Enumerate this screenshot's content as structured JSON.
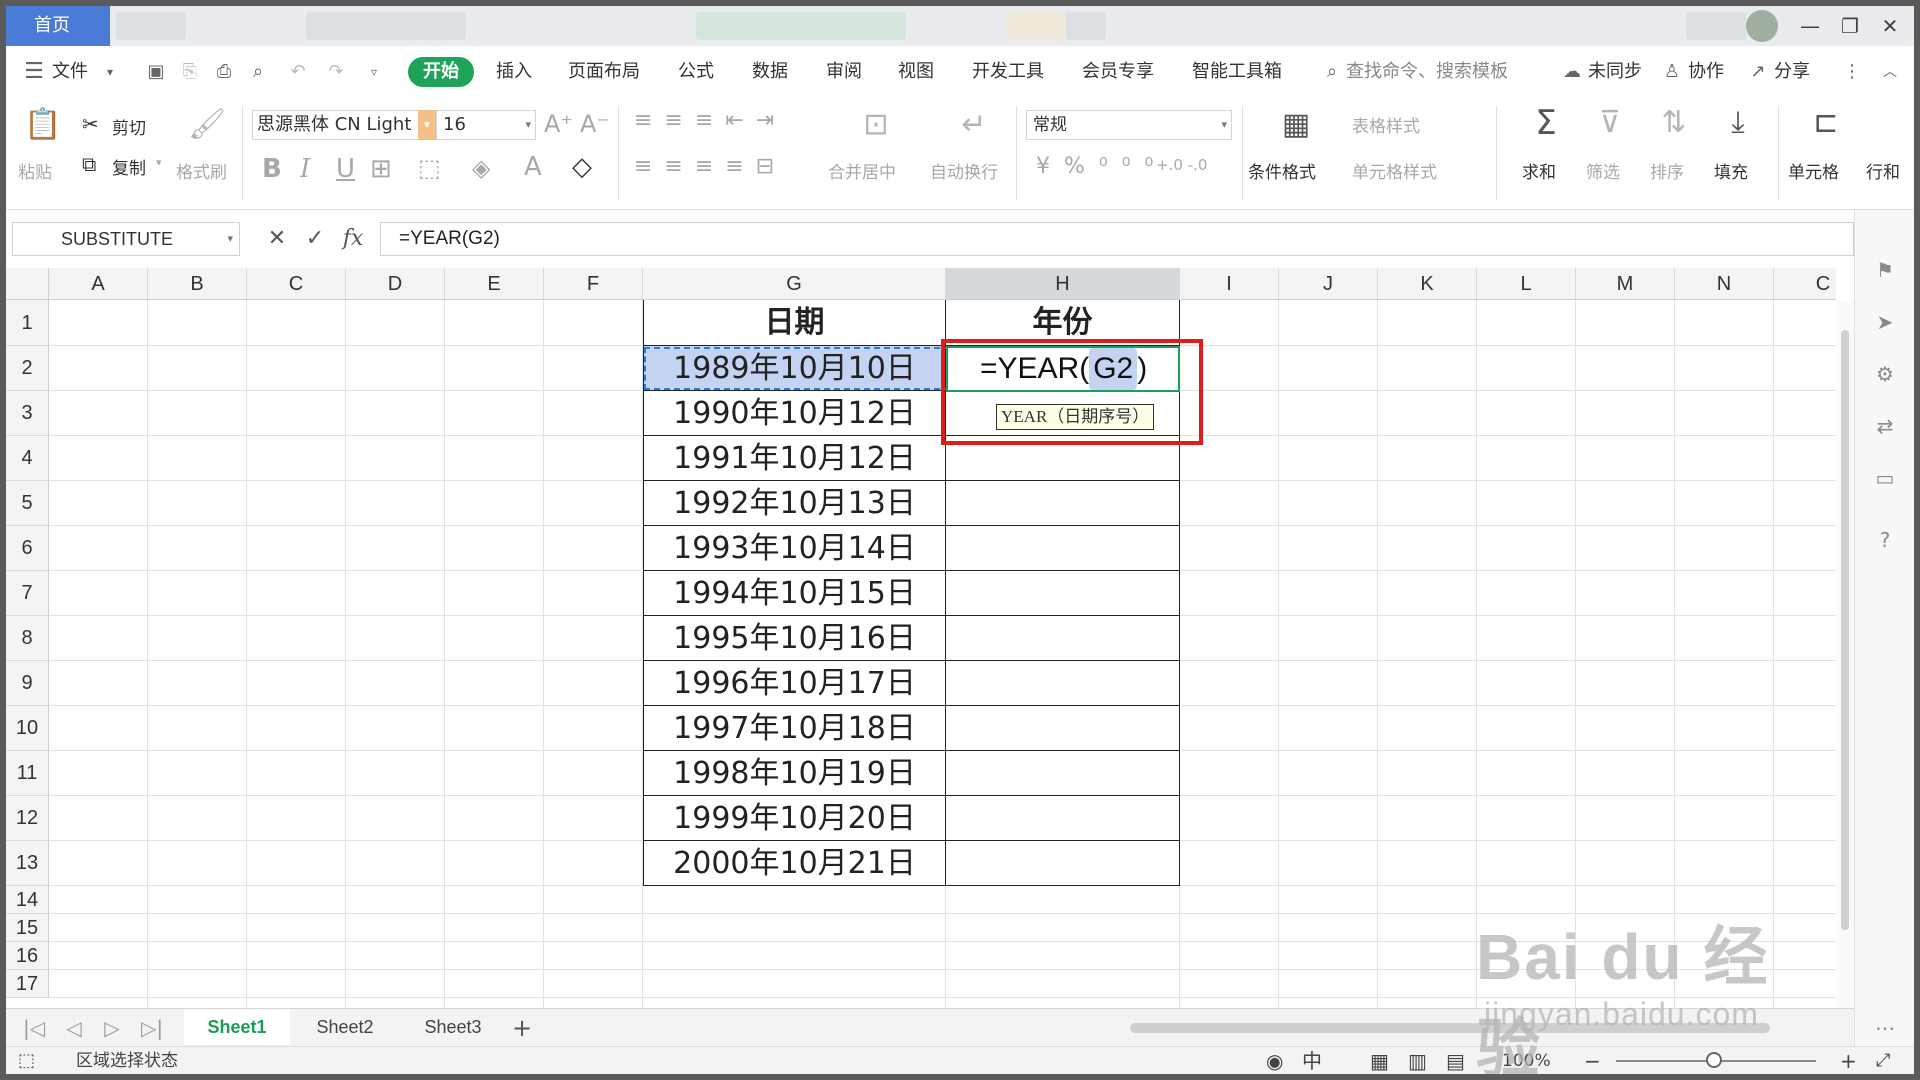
{
  "tabs": {
    "home": "首页"
  },
  "window": {
    "minimize": "—",
    "restore": "❐",
    "close": "✕"
  },
  "menu": {
    "file": "文件",
    "items": [
      "开始",
      "插入",
      "页面布局",
      "公式",
      "数据",
      "审阅",
      "视图",
      "开发工具",
      "会员专享",
      "智能工具箱"
    ],
    "search": "查找命令、搜索模板",
    "sync": "未同步",
    "collab": "协作",
    "share": "分享"
  },
  "ribbon": {
    "paste": "粘贴",
    "cut": "剪切",
    "copy": "复制",
    "format_painter": "格式刷",
    "font_name": "思源黑体 CN Light",
    "font_size": "16",
    "merge": "合并居中",
    "wrap": "自动换行",
    "number_format": "常规",
    "cond_format": "条件格式",
    "table_style": "表格样式",
    "cell_style": "单元格样式",
    "sum": "求和",
    "filter": "筛选",
    "sort": "排序",
    "fill": "填充",
    "cell": "单元格",
    "rowcol": "行和"
  },
  "formula_bar": {
    "name_box": "SUBSTITUTE",
    "formula": "=YEAR(G2)"
  },
  "grid": {
    "columns": [
      "A",
      "B",
      "C",
      "D",
      "E",
      "F",
      "G",
      "H",
      "I",
      "J",
      "K",
      "L",
      "M",
      "N",
      "C"
    ],
    "rows": [
      "1",
      "2",
      "3",
      "4",
      "5",
      "6",
      "7",
      "8",
      "9",
      "10",
      "11",
      "12",
      "13",
      "14",
      "15",
      "16",
      "17"
    ],
    "header_g": "日期",
    "header_h": "年份",
    "dates": [
      "1989年10月10日",
      "1990年10月12日",
      "1991年10月12日",
      "1992年10月13日",
      "1993年10月14日",
      "1994年10月15日",
      "1995年10月16日",
      "1996年10月17日",
      "1997年10月18日",
      "1998年10月19日",
      "1999年10月20日",
      "2000年10月21日"
    ],
    "edit_prefix": "=YEAR(",
    "edit_ref": "G2",
    "edit_suffix": ")",
    "tooltip": "YEAR（日期序号）"
  },
  "sheets": [
    "Sheet1",
    "Sheet2",
    "Sheet3"
  ],
  "status": {
    "mode": "区域选择状态",
    "zoom": "100%"
  },
  "watermark": {
    "big": "Bai du 经验",
    "small": "jingyan.baidu.com"
  }
}
